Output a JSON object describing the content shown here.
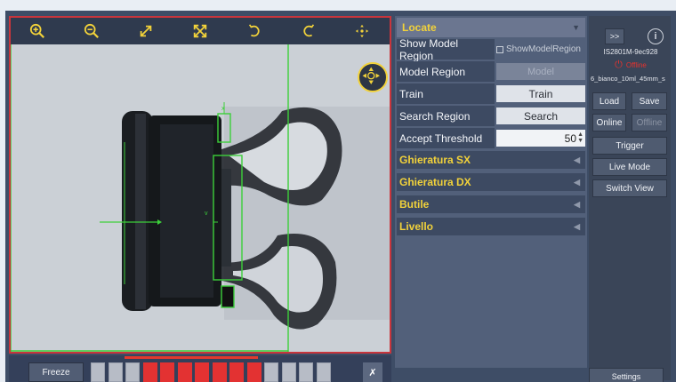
{
  "toolbar": {
    "icons": [
      "zoom-in",
      "zoom-out",
      "expand",
      "fit-cross",
      "rotate-ccw",
      "rotate-cw",
      "pan"
    ]
  },
  "viewer": {
    "roi_labels": {
      "small_box": "x",
      "tall_box": "v"
    }
  },
  "panel": {
    "tool_header": "Locate",
    "rows": {
      "show_model_region": {
        "label": "Show Model Region",
        "checkbox_label": "ShowModelRegion"
      },
      "model_region": {
        "label": "Model Region",
        "button": "Model"
      },
      "train": {
        "label": "Train",
        "button": "Train"
      },
      "search_region": {
        "label": "Search Region",
        "button": "Search"
      },
      "accept_threshold": {
        "label": "Accept Threshold",
        "value": "50"
      }
    },
    "sections": [
      "Ghieratura SX",
      "Ghieratura DX",
      "Butile",
      "Livello"
    ]
  },
  "side": {
    "expand_label": ">>",
    "device_name": "IS2801M-9ec928",
    "status": "Offline",
    "job_name": "6_bianco_10ml_45mm_s",
    "buttons": {
      "load": "Load",
      "save": "Save",
      "online": "Online",
      "offline": "Offline",
      "trigger": "Trigger",
      "live_mode": "Live Mode",
      "switch_view": "Switch View",
      "settings": "Settings"
    }
  },
  "bottom": {
    "freeze_label": "Freeze",
    "close_label": "✗",
    "thumbnails": [
      false,
      false,
      false,
      true,
      true,
      true,
      true,
      true,
      true,
      true,
      false,
      false,
      false,
      false
    ]
  },
  "colors": {
    "accent_yellow": "#f2d23a",
    "roi_green": "#3ccf3a",
    "border_red": "#c8353c",
    "status_red": "#e8322d"
  }
}
